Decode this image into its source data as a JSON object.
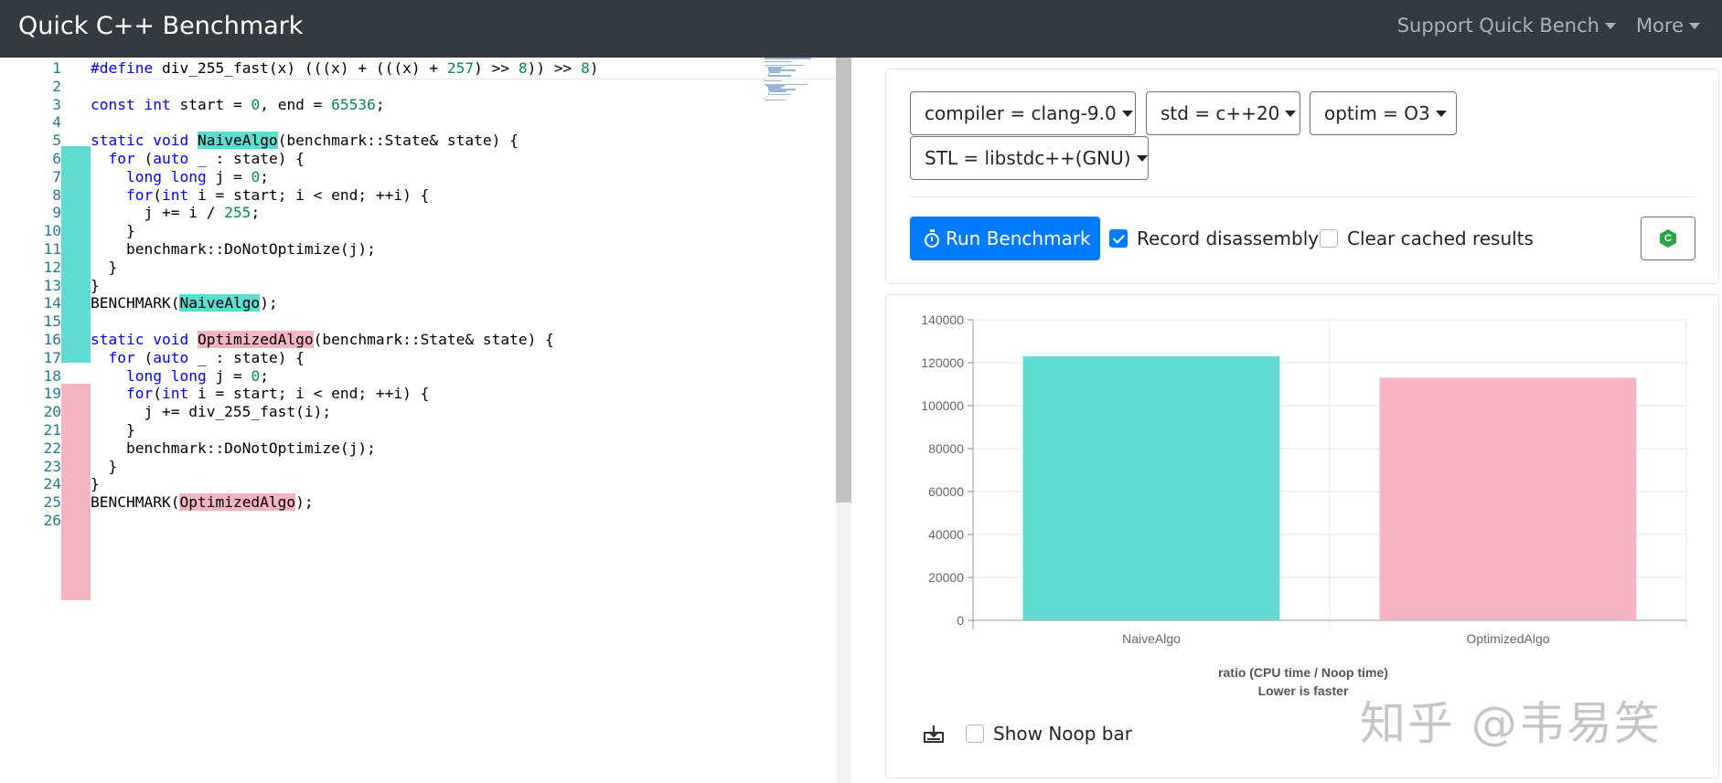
{
  "navbar": {
    "brand": "Quick C++ Benchmark",
    "links": [
      "Support Quick Bench",
      "More"
    ]
  },
  "editor": {
    "lines": [
      "#define div_255_fast(x) (((x) + (((x) + 257) >> 8)) >> 8)",
      "",
      "const int start = 0, end = 65536;",
      "",
      "static void NaiveAlgo(benchmark::State& state) {",
      "  for (auto _ : state) {",
      "    long long j = 0;",
      "    for(int i = start; i < end; ++i) {",
      "      j += i / 255;",
      "    }",
      "    benchmark::DoNotOptimize(j);",
      "  }",
      "}",
      "BENCHMARK(NaiveAlgo);",
      "",
      "static void OptimizedAlgo(benchmark::State& state) {",
      "  for (auto _ : state) {",
      "    long long j = 0;",
      "    for(int i = start; i < end; ++i) {",
      "      j += div_255_fast(i);",
      "    }",
      "    benchmark::DoNotOptimize(j);",
      "  }",
      "}",
      "BENCHMARK(OptimizedAlgo);",
      ""
    ]
  },
  "options": {
    "compiler": "compiler = clang-9.0",
    "std": "std = c++20",
    "optim": "optim = O3",
    "stl": "STL = libstdc++(GNU)"
  },
  "actions": {
    "run_label": "Run Benchmark",
    "record_disassembly": "Record disassembly",
    "clear_cached": "Clear cached results",
    "show_noop": "Show Noop bar"
  },
  "colors": {
    "accent": "#007bff",
    "naive": "#5fdbcf",
    "optimized": "#f4b4c1",
    "navbar": "#343a40"
  },
  "chart_data": {
    "type": "bar",
    "categories": [
      "NaiveAlgo",
      "OptimizedAlgo"
    ],
    "values": [
      123000,
      113000
    ],
    "colors": [
      "#5fdbcf",
      "#f4b4c1"
    ],
    "ylim": [
      0,
      140000
    ],
    "yticks": [
      0,
      20000,
      40000,
      60000,
      80000,
      100000,
      120000,
      140000
    ],
    "xlabel": "ratio (CPU time / Noop time)",
    "xlabel2": "Lower is faster",
    "ylabel": "",
    "grid": true
  },
  "watermark": "知乎 @韦易笑"
}
